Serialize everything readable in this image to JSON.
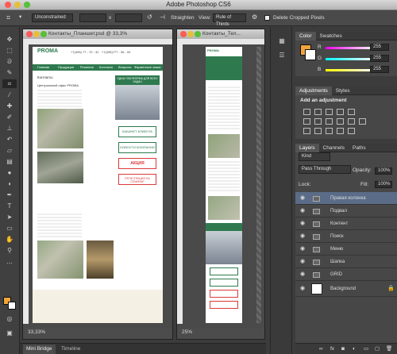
{
  "app_title": "Adobe Photoshop CS6",
  "options_bar": {
    "crop_preset": "Unconstrained",
    "straighten_label": "Straighten",
    "view_label": "View:",
    "view_value": "Rule of Thirds",
    "delete_cropped_label": "Delete Cropped Pixels",
    "swap_label": "⇄",
    "x_label": "x"
  },
  "doc1": {
    "title": "Контакты_Планшет.psd @ 33,3%",
    "zoom": "33,33%",
    "site": {
      "logo": "PROMA",
      "nav": [
        "Главная",
        "Продукция",
        "Решения",
        "Контакты",
        "Вопросы",
        "Фирменные знаки"
      ],
      "section_title": "Контакты",
      "office_title": "Центральный офис PROMA",
      "promo_caption": "ОДНА ПЛАТФОРМА ДЛЯ ВСЕХ ЗАДАЧ",
      "buttons": [
        "КАБИНЕТ КЛИЕНТА",
        "НОВОСТИ КОМПАНИИ",
        "АКЦИЯ",
        "РЕГИСТРАЦИЯ НА СЕМИНАР"
      ]
    }
  },
  "doc2": {
    "title": "Контакты_Тел...",
    "zoom": "25%"
  },
  "panels": {
    "color_tabs": [
      "Color",
      "Swatches"
    ],
    "rgb": [
      {
        "label": "R",
        "value": "255"
      },
      {
        "label": "G",
        "value": "255"
      },
      {
        "label": "B",
        "value": "255"
      }
    ],
    "adj_tabs": [
      "Adjustments",
      "Styles"
    ],
    "adj_title": "Add an adjustment",
    "layers_tabs": [
      "Layers",
      "Channels",
      "Paths"
    ],
    "kind_label": "Kind",
    "blend_mode": "Pass Through",
    "opacity_label": "Opacity:",
    "opacity_value": "100%",
    "lock_label": "Lock:",
    "fill_label": "Fill:",
    "fill_value": "100%",
    "layers": [
      "Правая колонка",
      "Подвал",
      "Контент",
      "Поиск",
      "Меню",
      "Шапка",
      "GRID"
    ],
    "background_layer": "Background"
  },
  "bottom_tabs": [
    "Mini Bridge",
    "Timeline"
  ],
  "colors": {
    "accent_green": "#2e7a4e",
    "promo_red": "#d93a3a",
    "selected_layer": "#5a6c87"
  }
}
